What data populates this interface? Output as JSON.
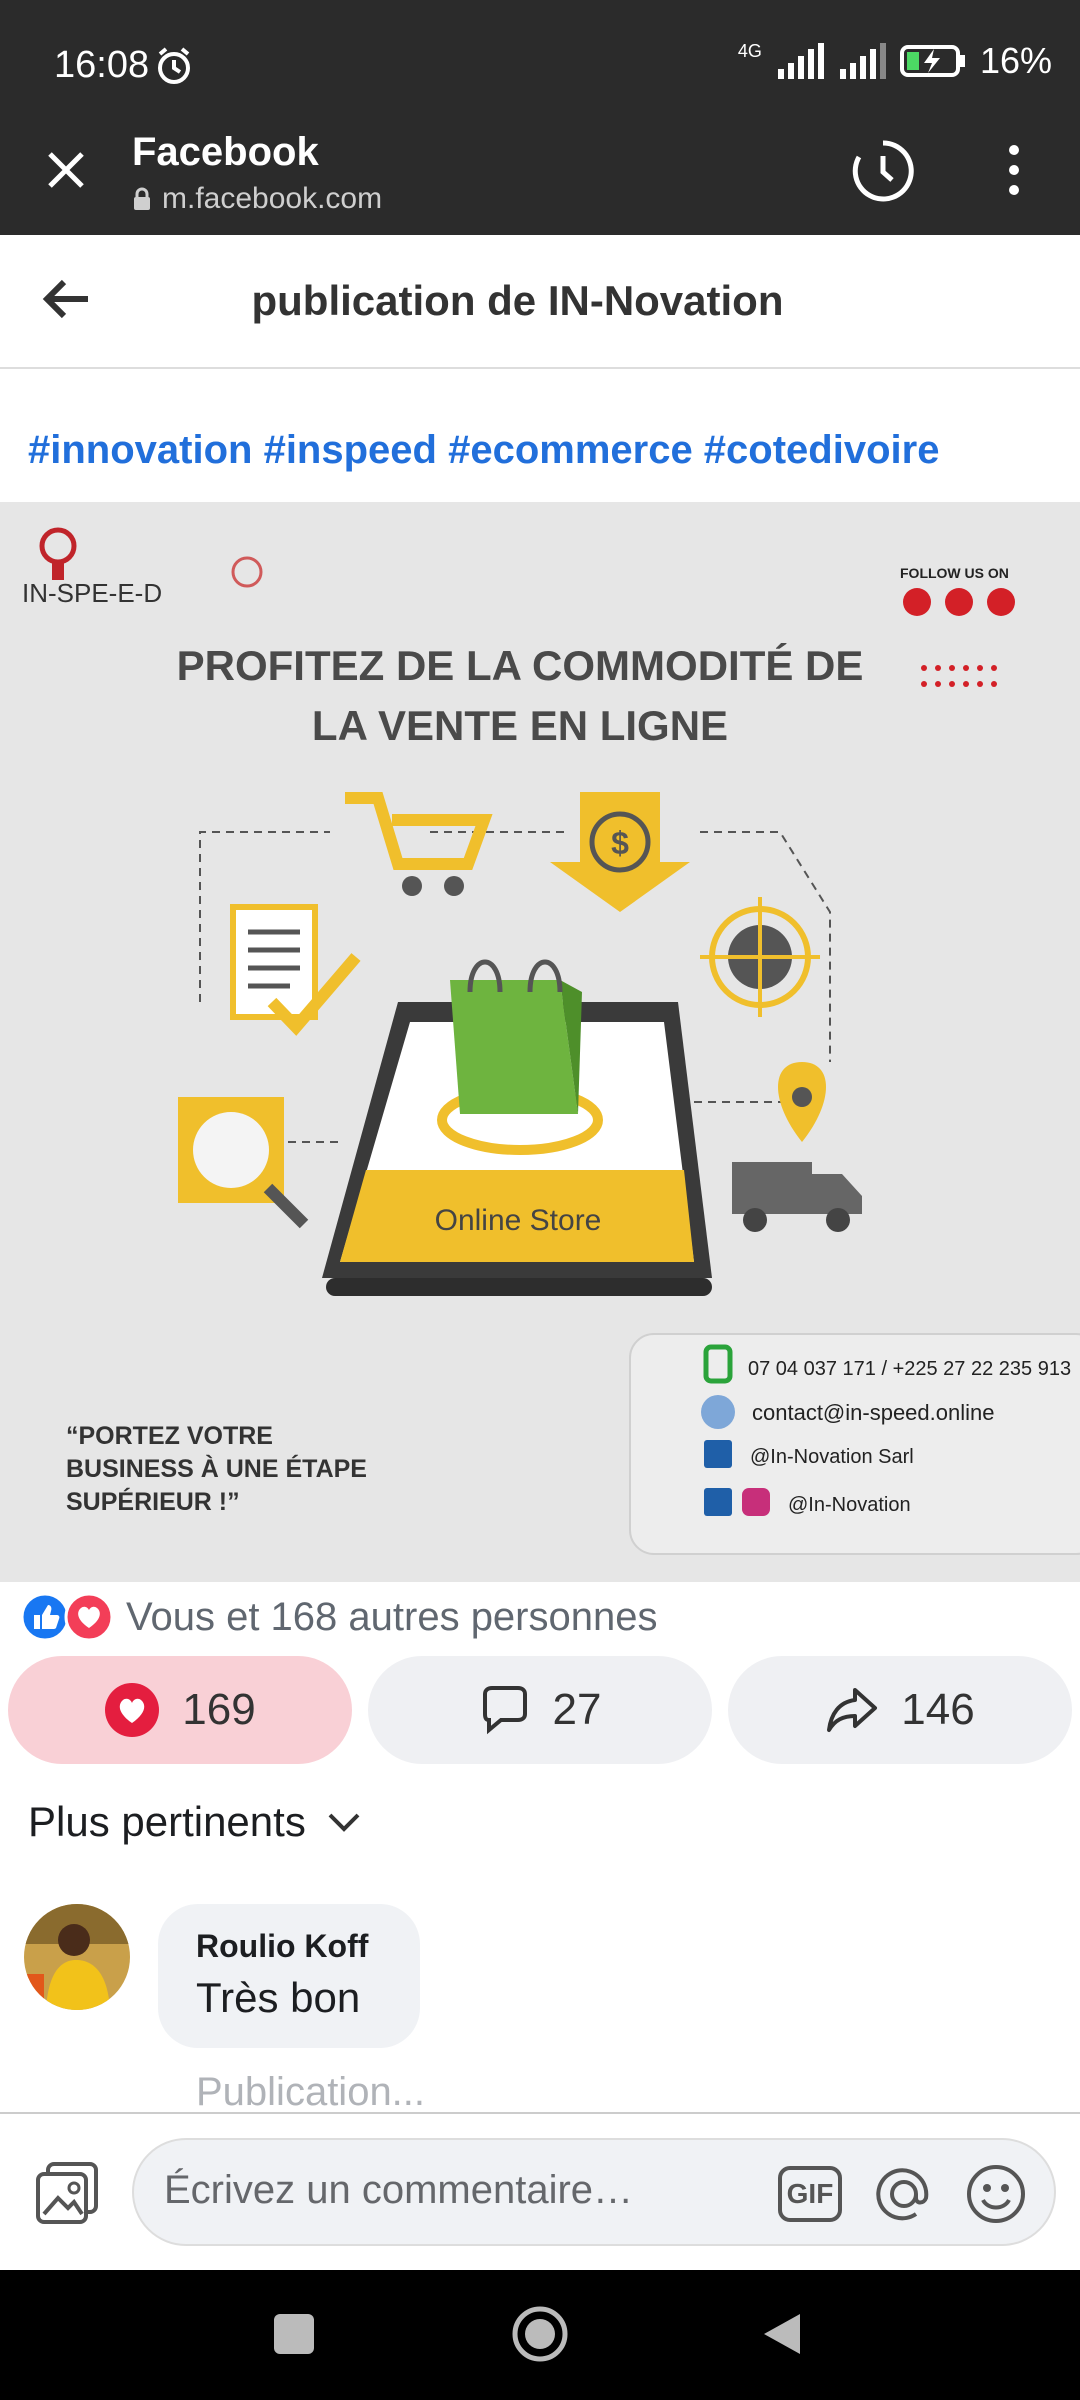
{
  "status": {
    "time": "16:08",
    "network": "4G",
    "battery": "16%"
  },
  "browser": {
    "title": "Facebook",
    "url": "m.facebook.com"
  },
  "header": {
    "title": "publication de IN-Novation"
  },
  "post": {
    "hashtags": "#innovation #inspeed #ecommerce #cotedivoire",
    "image": {
      "logo": "IN-SPE-E-D",
      "follow_label": "FOLLOW US ON",
      "headline_1": "PROFITEZ DE LA COMMODITÉ DE",
      "headline_2": "LA VENTE EN LIGNE",
      "store_label": "Online Store",
      "quote_1": "“PORTEZ VOTRE",
      "quote_2": "BUSINESS À UNE ÉTAPE",
      "quote_3": "SUPÉRIEUR !”",
      "phone": "07 04 037 171 / +225 27 22 235 913",
      "email": "contact@in-speed.online",
      "linkedin": "@In-Novation Sarl",
      "social": "@In-Novation",
      "colors": {
        "yellow": "#f0bf2c",
        "red": "#d32027",
        "bg": "#e6e6e6"
      }
    },
    "reactions_summary": "Vous et 168 autres personnes",
    "likes": "169",
    "comments": "27",
    "shares": "146"
  },
  "comments": {
    "sort_label": "Plus pertinents",
    "items": [
      {
        "author": "Roulio Koff",
        "text": "Très bon"
      }
    ],
    "publication_hint": "Publication..."
  },
  "composer": {
    "placeholder": "Écrivez un commentaire…",
    "gif_label": "GIF"
  }
}
